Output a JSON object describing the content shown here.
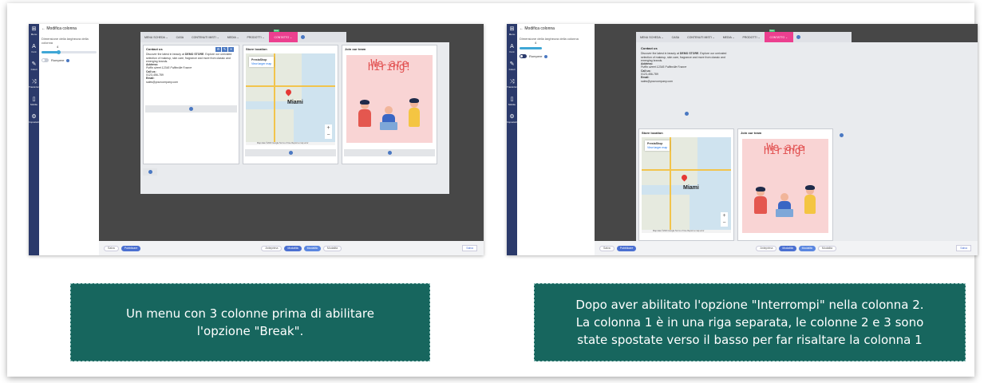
{
  "left_shot": {
    "panel": {
      "back_title": "← Modifica colonna",
      "width_label": "Dimensione della larghezza della colonna",
      "slider_value": "4",
      "slider_fraction": 0.33,
      "toggle_label": "Rompere"
    },
    "iconbar": [
      "Menu",
      "Font",
      "Colori",
      "Transizione",
      "Mobile",
      "Impostazioni"
    ],
    "menubar": [
      "MENU SCHEDA ⌄",
      "CASA",
      "CONTENUTI MISTI ⌄",
      "MEDIA ⌄",
      "PRODOTTI ⌄",
      "CONTATTO ⌄"
    ],
    "new_badge": "New",
    "bottombar": {
      "save_prev": "Salva",
      "publish": "Pubblicare",
      "preview": "Anteprima",
      "edit": "Modalità",
      "mode2": "Modalità",
      "mode3": "Modalità",
      "save": "Salva"
    }
  },
  "right_shot": {
    "panel": {
      "back_title": "← Modifica colonna",
      "width_label": "Dimensione della larghezza della colonna",
      "slider_value": "4",
      "slider_fraction": 0.33,
      "toggle_label": "Rompere"
    },
    "iconbar": [
      "Menu",
      "Font",
      "Colori",
      "Transizione",
      "Mobile",
      "Impostazioni"
    ],
    "menubar": [
      "MENU SCHEDA ⌄",
      "CASA",
      "CONTENUTI MISTI ⌄",
      "MEDIA ⌄",
      "PRODOTTI ⌄",
      "CONTATTO ⌄"
    ],
    "new_badge": "New",
    "bottombar": {
      "save_prev": "Salva",
      "publish": "Pubblicare",
      "preview": "Anteprima",
      "edit": "Modalità",
      "mode2": "Modalità",
      "mode3": "Modalità",
      "save": "Salva"
    }
  },
  "columns": {
    "contact": {
      "title": "Contact us",
      "text1": "Discover the latest in beauty at ",
      "store": "DEMO STORE",
      "text2": ". Explore our unrivaled selection of makeup, skin care, fragrance and more from classic and emerging brands.",
      "address_label": "Address:",
      "address": "Puffin street 12345 Puffinville France",
      "call_label": "Call us:",
      "phone": "0123-456-789",
      "email_label": "Email:",
      "email": "sales@yourcompany.com"
    },
    "store": {
      "title": "Store location",
      "map_name": "PrestaShop",
      "map_link": "View larger map",
      "city": "Miami",
      "map_footer": "Map data ©2023 Google  Terms of Use  Report a map error"
    },
    "team": {
      "title": "Join our team",
      "hiring": "We are hiring!"
    }
  },
  "captions": {
    "left": "Un menu con 3 colonne prima di abilitare l'opzione \"Break\".",
    "right_line1": "Dopo aver abilitato l'opzione \"Interrompi\" nella colonna 2.",
    "right_line2": "La colonna 1 è in una riga separata, le colonne 2 e 3 sono",
    "right_line3": "state spostate verso il basso per far risaltare la colonna 1"
  },
  "colors": {
    "sidebar": "#2b3a6b",
    "canvas": "#474747",
    "contact_tab": "#ec3f8f",
    "caption_bg": "#17665e",
    "accent": "#4a78c2"
  }
}
